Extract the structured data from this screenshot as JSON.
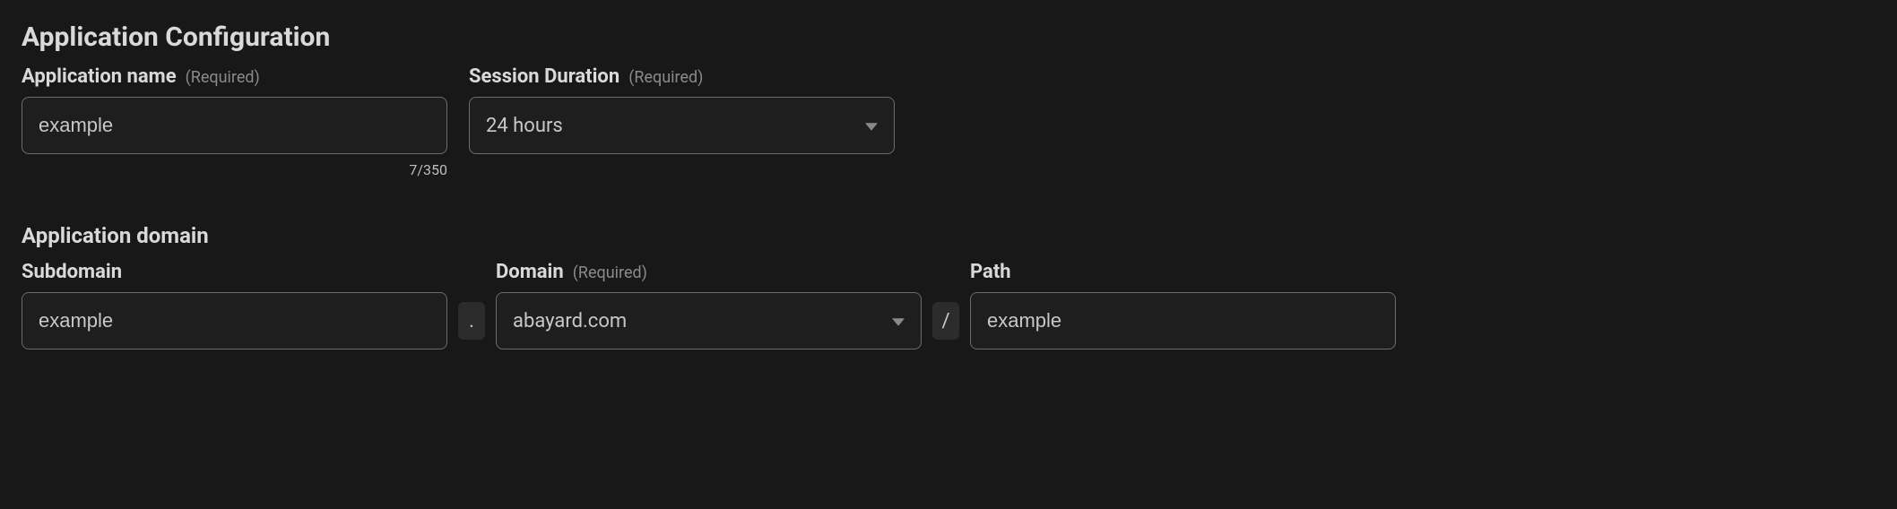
{
  "section": {
    "title": "Application Configuration"
  },
  "required_label": "(Required)",
  "app_name": {
    "label": "Application name",
    "value": "example",
    "counter": "7/350"
  },
  "session_duration": {
    "label": "Session Duration",
    "selected": "24 hours"
  },
  "app_domain": {
    "title": "Application domain",
    "subdomain": {
      "label": "Subdomain",
      "value": "example"
    },
    "dot_separator": ".",
    "domain": {
      "label": "Domain",
      "selected": "abayard.com"
    },
    "slash_separator": "/",
    "path": {
      "label": "Path",
      "value": "example"
    }
  }
}
